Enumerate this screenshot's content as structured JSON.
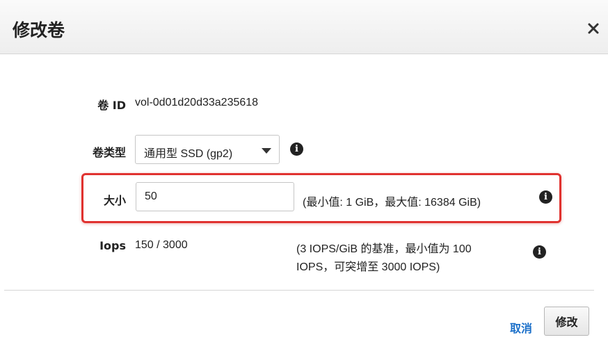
{
  "dialog": {
    "title": "修改卷",
    "close_glyph": "×"
  },
  "fields": {
    "volume_id": {
      "label": "卷 ID",
      "value": "vol-0d01d20d33a235618"
    },
    "volume_type": {
      "label": "卷类型",
      "selected": "通用型 SSD (gp2)"
    },
    "size": {
      "label": "大小",
      "value": "50",
      "hint": "(最小值: 1 GiB，最大值: 16384 GiB)"
    },
    "iops": {
      "label": "Iops",
      "value": "150 / 3000",
      "hint_line1": "(3 IOPS/GiB 的基准，最小值为 100",
      "hint_line2": "IOPS，可突增至 3000 IOPS)"
    }
  },
  "info_glyph": "i",
  "footer": {
    "cancel_label": "取消",
    "submit_label": "修改"
  },
  "colors": {
    "highlight_border": "#e0322f",
    "link": "#1a6fc9"
  },
  "icons": [
    "close-icon",
    "chevron-down-icon",
    "info-icon"
  ]
}
